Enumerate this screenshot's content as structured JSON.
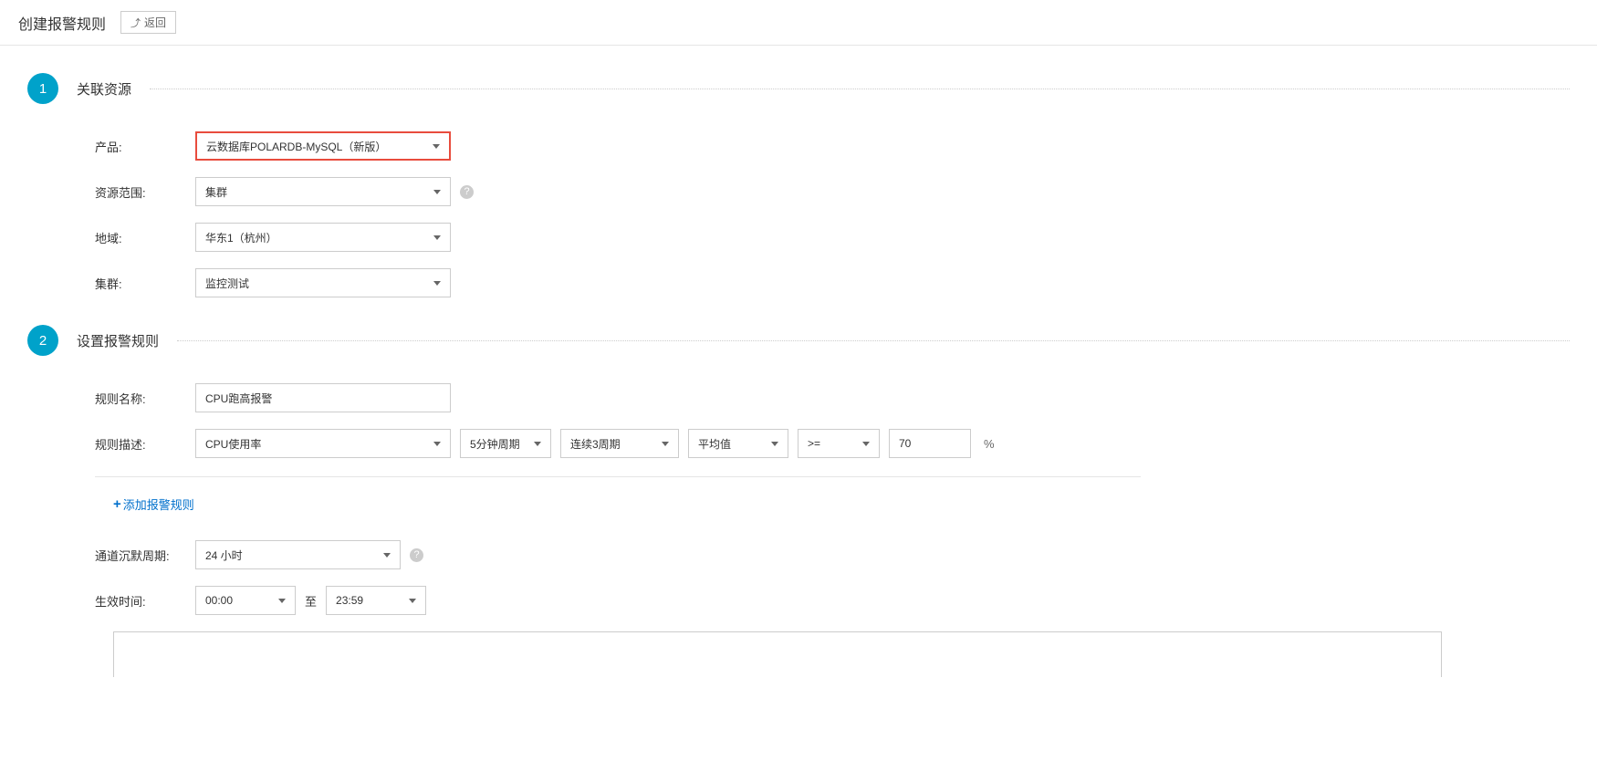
{
  "header": {
    "title": "创建报警规则",
    "back_label": "返回"
  },
  "section1": {
    "step": "1",
    "title": "关联资源",
    "fields": {
      "product_label": "产品:",
      "product_value": "云数据库POLARDB-MySQL（新版）",
      "scope_label": "资源范围:",
      "scope_value": "集群",
      "region_label": "地域:",
      "region_value": "华东1（杭州）",
      "cluster_label": "集群:",
      "cluster_value": "监控测试"
    }
  },
  "section2": {
    "step": "2",
    "title": "设置报警规则",
    "fields": {
      "rule_name_label": "规则名称:",
      "rule_name_value": "CPU跑高报警",
      "rule_desc_label": "规则描述:",
      "metric_value": "CPU使用率",
      "period_value": "5分钟周期",
      "consecutive_value": "连续3周期",
      "stat_value": "平均值",
      "operator_value": ">=",
      "threshold_value": "70",
      "percent": "%",
      "add_rule_label": "添加报警规则",
      "silence_label": "通道沉默周期:",
      "silence_value": "24 小时",
      "effective_label": "生效时间:",
      "time_start": "00:00",
      "time_separator": "至",
      "time_end": "23:59"
    }
  }
}
